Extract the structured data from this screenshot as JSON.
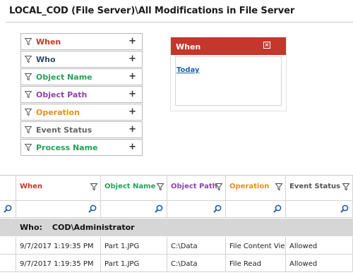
{
  "title": "LOCAL_COD (File Server)\\All Modifications in File Server",
  "filters": [
    {
      "label": "When",
      "color": "#c0392b"
    },
    {
      "label": "Who",
      "color": "#2f4a6e"
    },
    {
      "label": "Object Name",
      "color": "#27a05a"
    },
    {
      "label": "Object Path",
      "color": "#8e44ad"
    },
    {
      "label": "Operation",
      "color": "#e0901a"
    },
    {
      "label": "Event Status",
      "color": "#666666"
    },
    {
      "label": "Process Name",
      "color": "#27a05a"
    }
  ],
  "when_panel": {
    "title": "When",
    "link": "Today",
    "header_color": "#c5362b"
  },
  "grid": {
    "columns": [
      {
        "label": "When",
        "color": "#c0392b"
      },
      {
        "label": "Object Name",
        "color": "#27a05a"
      },
      {
        "label": "Object Path",
        "color": "#8e44ad"
      },
      {
        "label": "Operation",
        "color": "#e0901a"
      },
      {
        "label": "Event Status",
        "color": "#555555"
      }
    ],
    "group": {
      "label": "Who:",
      "value": "COD\\Administrator"
    },
    "rows": [
      [
        "9/7/2017 1:19:35 PM",
        "Part 1.JPG",
        "C:\\Data",
        "File Content View",
        "Allowed"
      ],
      [
        "9/7/2017 1:19:35 PM",
        "Part 1.JPG",
        "C:\\Data",
        "File Read",
        "Allowed"
      ]
    ]
  }
}
